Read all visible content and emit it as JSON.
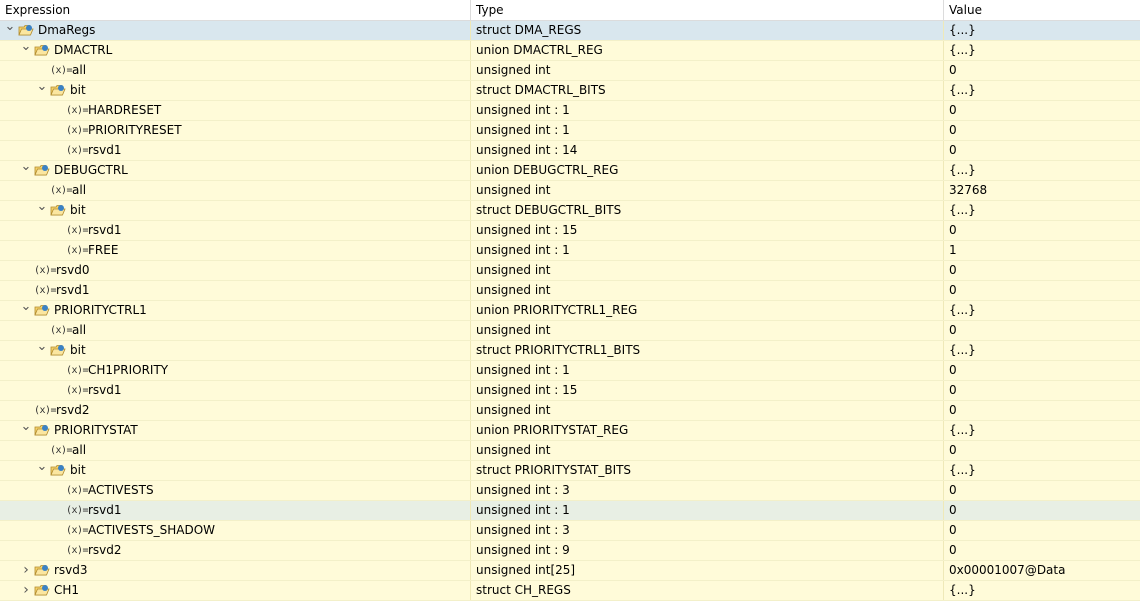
{
  "columns": {
    "expression": "Expression",
    "type": "Type",
    "value": "Value"
  },
  "rows": [
    {
      "depth": 0,
      "kind": "struct",
      "expand": "open",
      "name": "DmaRegs",
      "type": "struct DMA_REGS",
      "value": "{...}"
    },
    {
      "depth": 1,
      "kind": "struct",
      "expand": "open",
      "name": "DMACTRL",
      "type": "union DMACTRL_REG",
      "value": "{...}"
    },
    {
      "depth": 2,
      "kind": "var",
      "expand": "none",
      "name": "all",
      "type": "unsigned int",
      "value": "0"
    },
    {
      "depth": 2,
      "kind": "struct",
      "expand": "open",
      "name": "bit",
      "type": "struct DMACTRL_BITS",
      "value": "{...}"
    },
    {
      "depth": 3,
      "kind": "var",
      "expand": "none",
      "name": "HARDRESET",
      "type": "unsigned int : 1",
      "value": "0"
    },
    {
      "depth": 3,
      "kind": "var",
      "expand": "none",
      "name": "PRIORITYRESET",
      "type": "unsigned int : 1",
      "value": "0"
    },
    {
      "depth": 3,
      "kind": "var",
      "expand": "none",
      "name": "rsvd1",
      "type": "unsigned int : 14",
      "value": "0"
    },
    {
      "depth": 1,
      "kind": "struct",
      "expand": "open",
      "name": "DEBUGCTRL",
      "type": "union DEBUGCTRL_REG",
      "value": "{...}"
    },
    {
      "depth": 2,
      "kind": "var",
      "expand": "none",
      "name": "all",
      "type": "unsigned int",
      "value": "32768"
    },
    {
      "depth": 2,
      "kind": "struct",
      "expand": "open",
      "name": "bit",
      "type": "struct DEBUGCTRL_BITS",
      "value": "{...}"
    },
    {
      "depth": 3,
      "kind": "var",
      "expand": "none",
      "name": "rsvd1",
      "type": "unsigned int : 15",
      "value": "0"
    },
    {
      "depth": 3,
      "kind": "var",
      "expand": "none",
      "name": "FREE",
      "type": "unsigned int : 1",
      "value": "1"
    },
    {
      "depth": 1,
      "kind": "var",
      "expand": "none",
      "name": "rsvd0",
      "type": "unsigned int",
      "value": "0"
    },
    {
      "depth": 1,
      "kind": "var",
      "expand": "none",
      "name": "rsvd1",
      "type": "unsigned int",
      "value": "0"
    },
    {
      "depth": 1,
      "kind": "struct",
      "expand": "open",
      "name": "PRIORITYCTRL1",
      "type": "union PRIORITYCTRL1_REG",
      "value": "{...}"
    },
    {
      "depth": 2,
      "kind": "var",
      "expand": "none",
      "name": "all",
      "type": "unsigned int",
      "value": "0"
    },
    {
      "depth": 2,
      "kind": "struct",
      "expand": "open",
      "name": "bit",
      "type": "struct PRIORITYCTRL1_BITS",
      "value": "{...}"
    },
    {
      "depth": 3,
      "kind": "var",
      "expand": "none",
      "name": "CH1PRIORITY",
      "type": "unsigned int : 1",
      "value": "0"
    },
    {
      "depth": 3,
      "kind": "var",
      "expand": "none",
      "name": "rsvd1",
      "type": "unsigned int : 15",
      "value": "0"
    },
    {
      "depth": 1,
      "kind": "var",
      "expand": "none",
      "name": "rsvd2",
      "type": "unsigned int",
      "value": "0"
    },
    {
      "depth": 1,
      "kind": "struct",
      "expand": "open",
      "name": "PRIORITYSTAT",
      "type": "union PRIORITYSTAT_REG",
      "value": "{...}"
    },
    {
      "depth": 2,
      "kind": "var",
      "expand": "none",
      "name": "all",
      "type": "unsigned int",
      "value": "0"
    },
    {
      "depth": 2,
      "kind": "struct",
      "expand": "open",
      "name": "bit",
      "type": "struct PRIORITYSTAT_BITS",
      "value": "{...}"
    },
    {
      "depth": 3,
      "kind": "var",
      "expand": "none",
      "name": "ACTIVESTS",
      "type": "unsigned int : 3",
      "value": "0"
    },
    {
      "depth": 3,
      "kind": "var",
      "expand": "none",
      "name": "rsvd1",
      "type": "unsigned int : 1",
      "value": "0",
      "selected": true
    },
    {
      "depth": 3,
      "kind": "var",
      "expand": "none",
      "name": "ACTIVESTS_SHADOW",
      "type": "unsigned int : 3",
      "value": "0"
    },
    {
      "depth": 3,
      "kind": "var",
      "expand": "none",
      "name": "rsvd2",
      "type": "unsigned int : 9",
      "value": "0"
    },
    {
      "depth": 1,
      "kind": "struct",
      "expand": "closed",
      "name": "rsvd3",
      "type": "unsigned int[25]",
      "value": "0x00001007@Data"
    },
    {
      "depth": 1,
      "kind": "struct",
      "expand": "closed",
      "name": "CH1",
      "type": "struct CH_REGS",
      "value": "{...}"
    }
  ],
  "icons": {
    "expanded": "chevron-down-icon",
    "collapsed": "chevron-right-icon",
    "struct": "struct-folder-icon",
    "variable": "variable-icon",
    "variable_glyph": "(x)="
  },
  "colors": {
    "row_bg": "#fffbd9",
    "selected_bg": "#e8efe4",
    "top_row_bg": "#d9e7ee",
    "folder_yellow": "#f5d26b",
    "folder_blue": "#3b82c4"
  }
}
